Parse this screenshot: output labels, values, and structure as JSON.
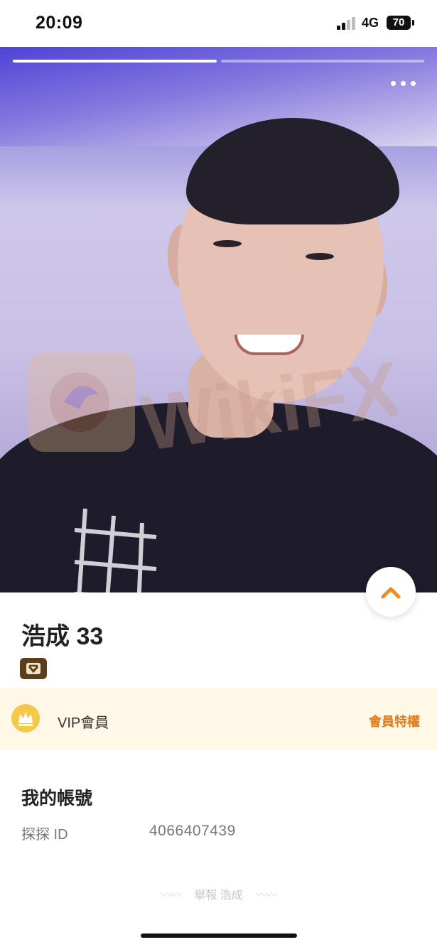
{
  "status_bar": {
    "time": "20:09",
    "network": "4G",
    "battery": "70"
  },
  "profile": {
    "name": "浩成 33",
    "story_progress": {
      "segments": 2,
      "active": 1
    }
  },
  "vip": {
    "label": "VIP會員",
    "link": "會員特權"
  },
  "account": {
    "title": "我的帳號",
    "id_label": "探探 ID",
    "id_value": "4066407439"
  },
  "footer": {
    "report": "舉報 浩成",
    "wave": "〰〰"
  },
  "watermark": "WikiFX",
  "colors": {
    "vip_background": "#fff8e6",
    "vip_accent": "#e07a1e",
    "crown": "#f7c74a",
    "collapse_arrow": "#f08a24"
  },
  "icons": {
    "more": "more-icon",
    "collapse": "chevron-up-icon",
    "crown": "crown-icon",
    "badge": "verified-badge-icon"
  }
}
